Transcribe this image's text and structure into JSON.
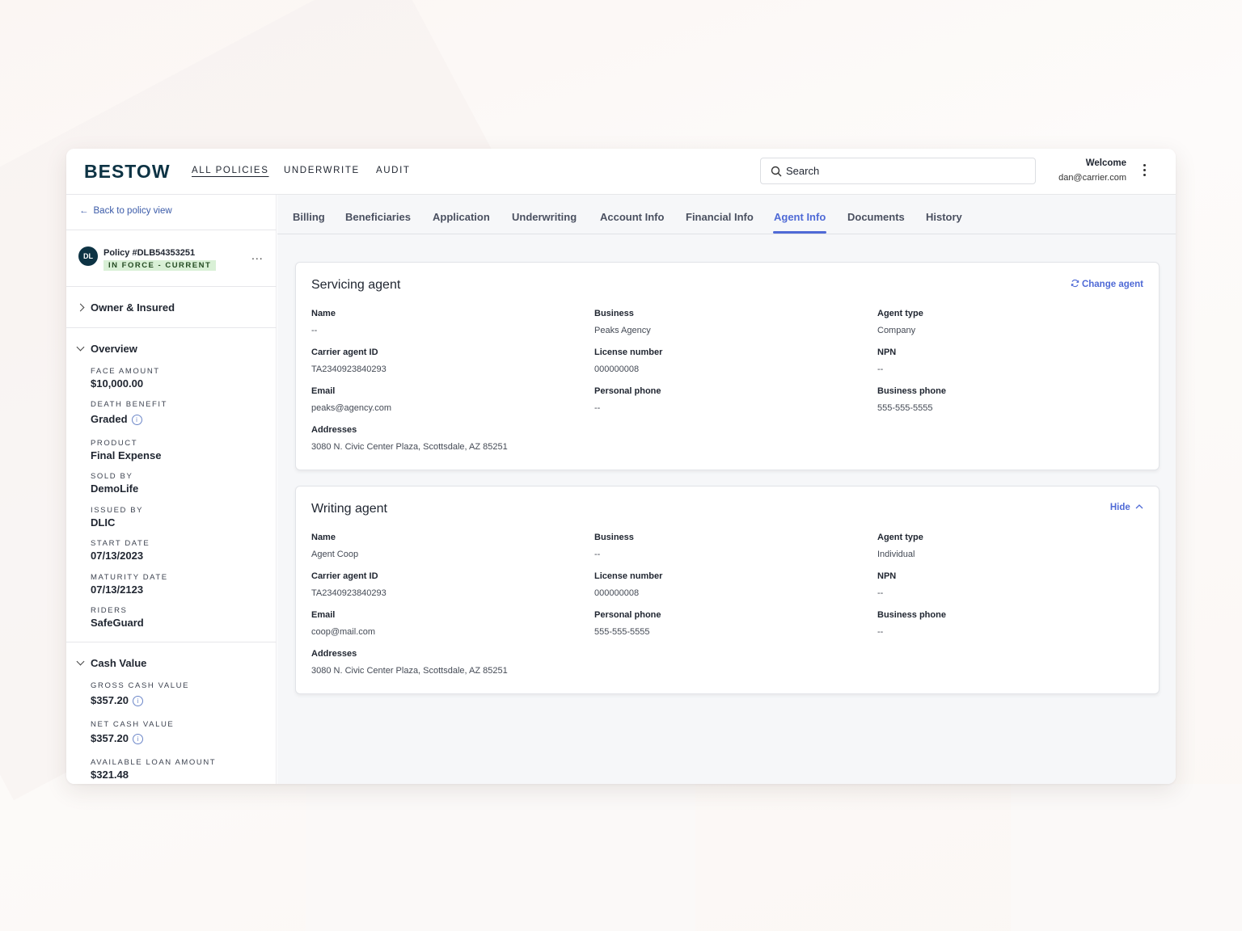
{
  "header": {
    "logo": "BESTOW",
    "nav": [
      "ALL POLICIES",
      "UNDERWRITE",
      "AUDIT"
    ],
    "search_placeholder": "Search",
    "welcome": "Welcome",
    "user_email": "dan@carrier.com"
  },
  "sidebar": {
    "back_label": "Back to policy view",
    "avatar_initials": "DL",
    "policy_number": "Policy #DLB54353251",
    "policy_status": "IN FORCE - CURRENT",
    "more": "...",
    "owner_section": "Owner & Insured",
    "overview_section": "Overview",
    "overview_fields": [
      {
        "label": "FACE AMOUNT",
        "value": "$10,000.00"
      },
      {
        "label": "DEATH BENEFIT",
        "value": "Graded"
      },
      {
        "label": "PRODUCT",
        "value": "Final Expense"
      },
      {
        "label": "SOLD BY",
        "value": "DemoLife"
      },
      {
        "label": "ISSUED BY",
        "value": "DLIC"
      },
      {
        "label": "START DATE",
        "value": "07/13/2023"
      },
      {
        "label": "MATURITY DATE",
        "value": "07/13/2123"
      },
      {
        "label": "RIDERS",
        "value": "SafeGuard"
      }
    ],
    "cash_section": "Cash Value",
    "cash_fields": [
      {
        "label": "GROSS CASH VALUE",
        "value": "$357.20"
      },
      {
        "label": "NET CASH VALUE",
        "value": "$357.20"
      },
      {
        "label": "AVAILABLE LOAN AMOUNT",
        "value": "$321.48"
      }
    ]
  },
  "tabs": [
    "Billing",
    "Beneficiaries",
    "Application",
    "Underwriting",
    "Account Info",
    "Financial Info",
    "Agent Info",
    "Documents",
    "History"
  ],
  "active_tab": "Agent Info",
  "servicing_agent": {
    "title": "Servicing agent",
    "action": "Change agent",
    "name_label": "Name",
    "name": "--",
    "business_label": "Business",
    "business": "Peaks Agency",
    "agent_type_label": "Agent type",
    "agent_type": "Company",
    "carrier_id_label": "Carrier agent ID",
    "carrier_id": "TA2340923840293",
    "license_label": "License number",
    "license": "000000008",
    "npn_label": "NPN",
    "npn": "--",
    "email_label": "Email",
    "email": "peaks@agency.com",
    "personal_phone_label": "Personal phone",
    "personal_phone": "--",
    "business_phone_label": "Business phone",
    "business_phone": "555-555-5555",
    "addresses_label": "Addresses",
    "addresses": "3080 N. Civic Center Plaza, Scottsdale, AZ 85251"
  },
  "writing_agent": {
    "title": "Writing agent",
    "action": "Hide",
    "name_label": "Name",
    "name": "Agent Coop",
    "business_label": "Business",
    "business": "--",
    "agent_type_label": "Agent type",
    "agent_type": "Individual",
    "carrier_id_label": "Carrier agent ID",
    "carrier_id": "TA2340923840293",
    "license_label": "License number",
    "license": "000000008",
    "npn_label": "NPN",
    "npn": "--",
    "email_label": "Email",
    "email": "coop@mail.com",
    "personal_phone_label": "Personal phone",
    "personal_phone": "555-555-5555",
    "business_phone_label": "Business phone",
    "business_phone": "--",
    "addresses_label": "Addresses",
    "addresses": "3080 N. Civic Center Plaza, Scottsdale, AZ 85251"
  },
  "colors": {
    "brand": "#0d3344",
    "accent": "#4f6ad6",
    "status_bg": "#d9f0d6"
  }
}
